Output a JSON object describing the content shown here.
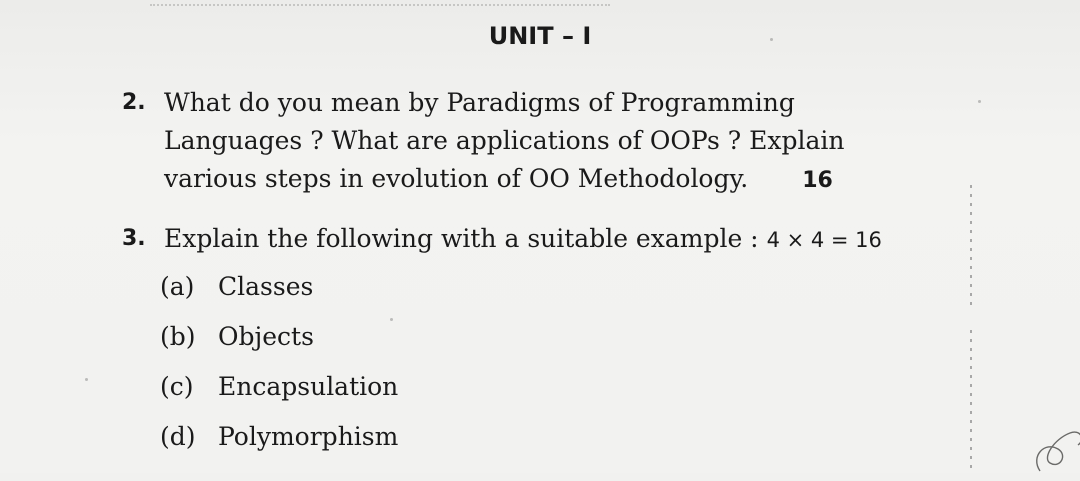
{
  "document": {
    "unit_heading": "UNIT – I",
    "questions": [
      {
        "number": "2.",
        "lines": [
          "What do you mean by Paradigms of Programming",
          "Languages ? What are applications of OOPs ? Explain",
          "various steps in evolution of OO Methodology."
        ],
        "marks": "16"
      },
      {
        "number": "3.",
        "text": "Explain the following with a suitable example :",
        "marks": "4 × 4 = 16",
        "subparts": [
          {
            "label": "(a)",
            "text": "Classes"
          },
          {
            "label": "(b)",
            "text": "Objects"
          },
          {
            "label": "(c)",
            "text": "Encapsulation"
          },
          {
            "label": "(d)",
            "text": "Polymorphism"
          }
        ]
      }
    ]
  }
}
